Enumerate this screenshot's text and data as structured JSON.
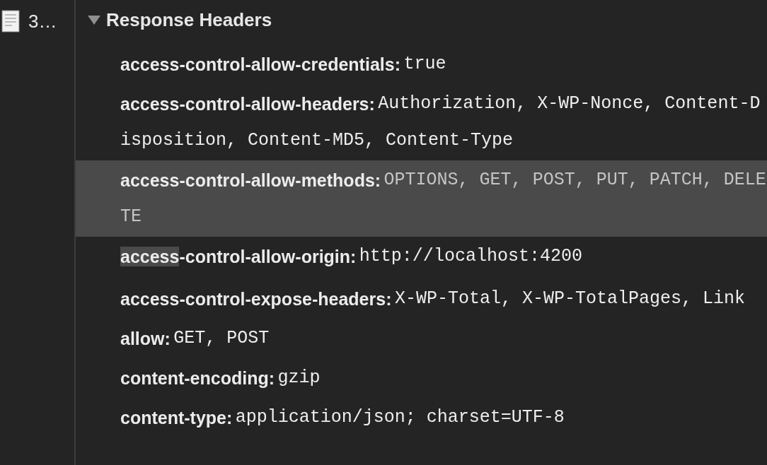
{
  "sidebar": {
    "items": [
      {
        "label": "3…",
        "selected": false
      }
    ]
  },
  "section": {
    "title": "Response Headers",
    "expanded": true
  },
  "headers": [
    {
      "key_parts": [
        {
          "text": "access-control-allow-credentials:",
          "highlighted": false
        }
      ],
      "value": "true",
      "selected": false
    },
    {
      "key_parts": [
        {
          "text": "access-control-allow-headers:",
          "highlighted": false
        }
      ],
      "value": "Authorization, X-WP-Nonce, Content-Disposition, Content-MD5, Content-Type",
      "selected": false
    },
    {
      "key_parts": [
        {
          "text": "access-control-allow-methods:",
          "highlighted": false
        }
      ],
      "value": "OPTIONS, GET, POST, PUT, PATCH, DELETE",
      "selected": true
    },
    {
      "key_parts": [
        {
          "text": "access",
          "highlighted": true
        },
        {
          "text": "-control-allow-origin:",
          "highlighted": false
        }
      ],
      "value": "http://localhost:4200",
      "selected": false
    },
    {
      "key_parts": [
        {
          "text": "access-control-expose-headers:",
          "highlighted": false
        }
      ],
      "value": "X-WP-Total, X-WP-TotalPages, Link",
      "selected": false
    },
    {
      "key_parts": [
        {
          "text": "allow:",
          "highlighted": false
        }
      ],
      "value": "GET, POST",
      "selected": false
    },
    {
      "key_parts": [
        {
          "text": "content-encoding:",
          "highlighted": false
        }
      ],
      "value": "gzip",
      "selected": false
    },
    {
      "key_parts": [
        {
          "text": "content-type:",
          "highlighted": false
        }
      ],
      "value": "application/json; charset=UTF-8",
      "selected": false
    }
  ]
}
